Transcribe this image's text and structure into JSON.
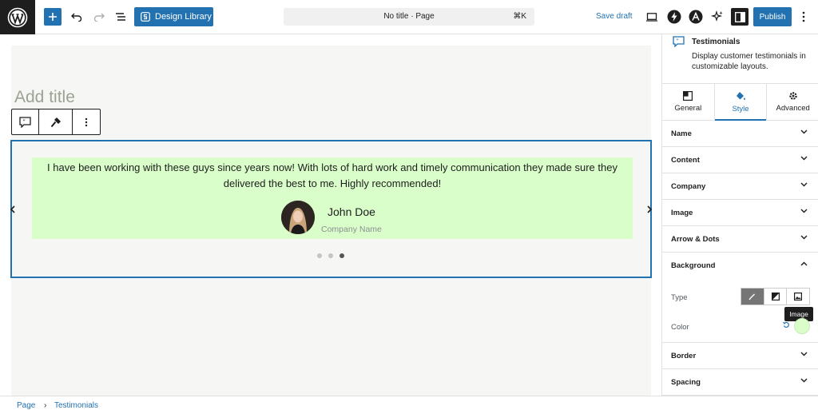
{
  "topbar": {
    "design_library_label": "Design Library",
    "command_title": "No title · Page",
    "command_shortcut": "⌘K",
    "save_draft_label": "Save draft",
    "publish_label": "Publish"
  },
  "editor": {
    "title_placeholder": "Add title"
  },
  "testimonial": {
    "quote": "I have been working with these guys since years now! With lots of hard work and timely communication they made sure they delivered the best to me. Highly recommended!",
    "name": "John Doe",
    "company": "Company Name",
    "bg_color": "#d9fec9",
    "slides": 3,
    "active_slide": 3
  },
  "sidebar": {
    "block_name": "Testimonials",
    "block_description": "Display customer testimonials in customizable layouts.",
    "tabs": [
      {
        "label": "General",
        "icon": "layout-icon"
      },
      {
        "label": "Style",
        "icon": "paint-bucket-icon"
      },
      {
        "label": "Advanced",
        "icon": "gear-icon"
      }
    ],
    "active_tab": "Style",
    "panels": {
      "name": "Name",
      "content": "Content",
      "company": "Company",
      "image": "Image",
      "arrow_dots": "Arrow & Dots",
      "background": "Background",
      "border": "Border",
      "spacing": "Spacing"
    },
    "background": {
      "type_label": "Type",
      "color_label": "Color",
      "tooltip": "Image",
      "color_value": "#d9fec9"
    }
  },
  "breadcrumb": {
    "root": "Page",
    "current": "Testimonials"
  },
  "colors": {
    "accent": "#2271b1",
    "dark": "#1e1e1e"
  }
}
